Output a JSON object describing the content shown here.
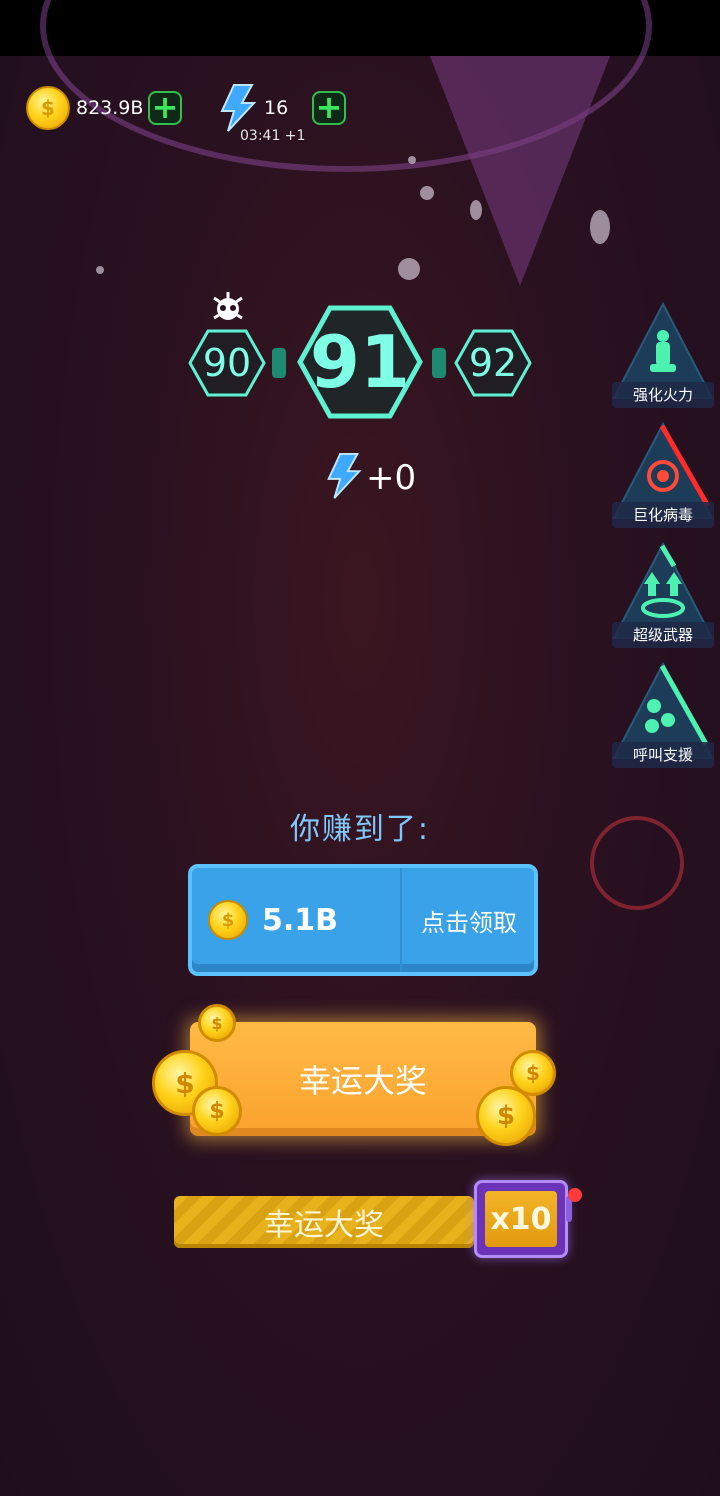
{
  "hud": {
    "coins": {
      "value": "823.9B",
      "icon": "coin-icon"
    },
    "energy": {
      "value": "16",
      "icon": "lightning-icon",
      "timer": "03:41 +1"
    }
  },
  "levels": {
    "previous": "90",
    "current": "91",
    "next": "92",
    "boss_icon": "virus-skull-icon"
  },
  "energy_gain": "+0",
  "side_buttons": [
    {
      "label": "强化火力",
      "icon": "turret-icon"
    },
    {
      "label": "巨化病毒",
      "icon": "virus-icon"
    },
    {
      "label": "超级武器",
      "icon": "upgrade-icon"
    },
    {
      "label": "呼叫支援",
      "icon": "rockets-icon"
    }
  ],
  "reward": {
    "title": "你赚到了:",
    "amount": "5.1B",
    "claim_label": "点击领取"
  },
  "jackpot_button": {
    "label": "幸运大奖"
  },
  "jackpot_bar": {
    "label": "幸运大奖",
    "multiplier": "x10"
  },
  "colors": {
    "claim_blue": "#3aa2e8",
    "jackpot_orange": "#fba12e",
    "level_teal": "#7fffe6",
    "title_blue": "#7ec8ff"
  }
}
